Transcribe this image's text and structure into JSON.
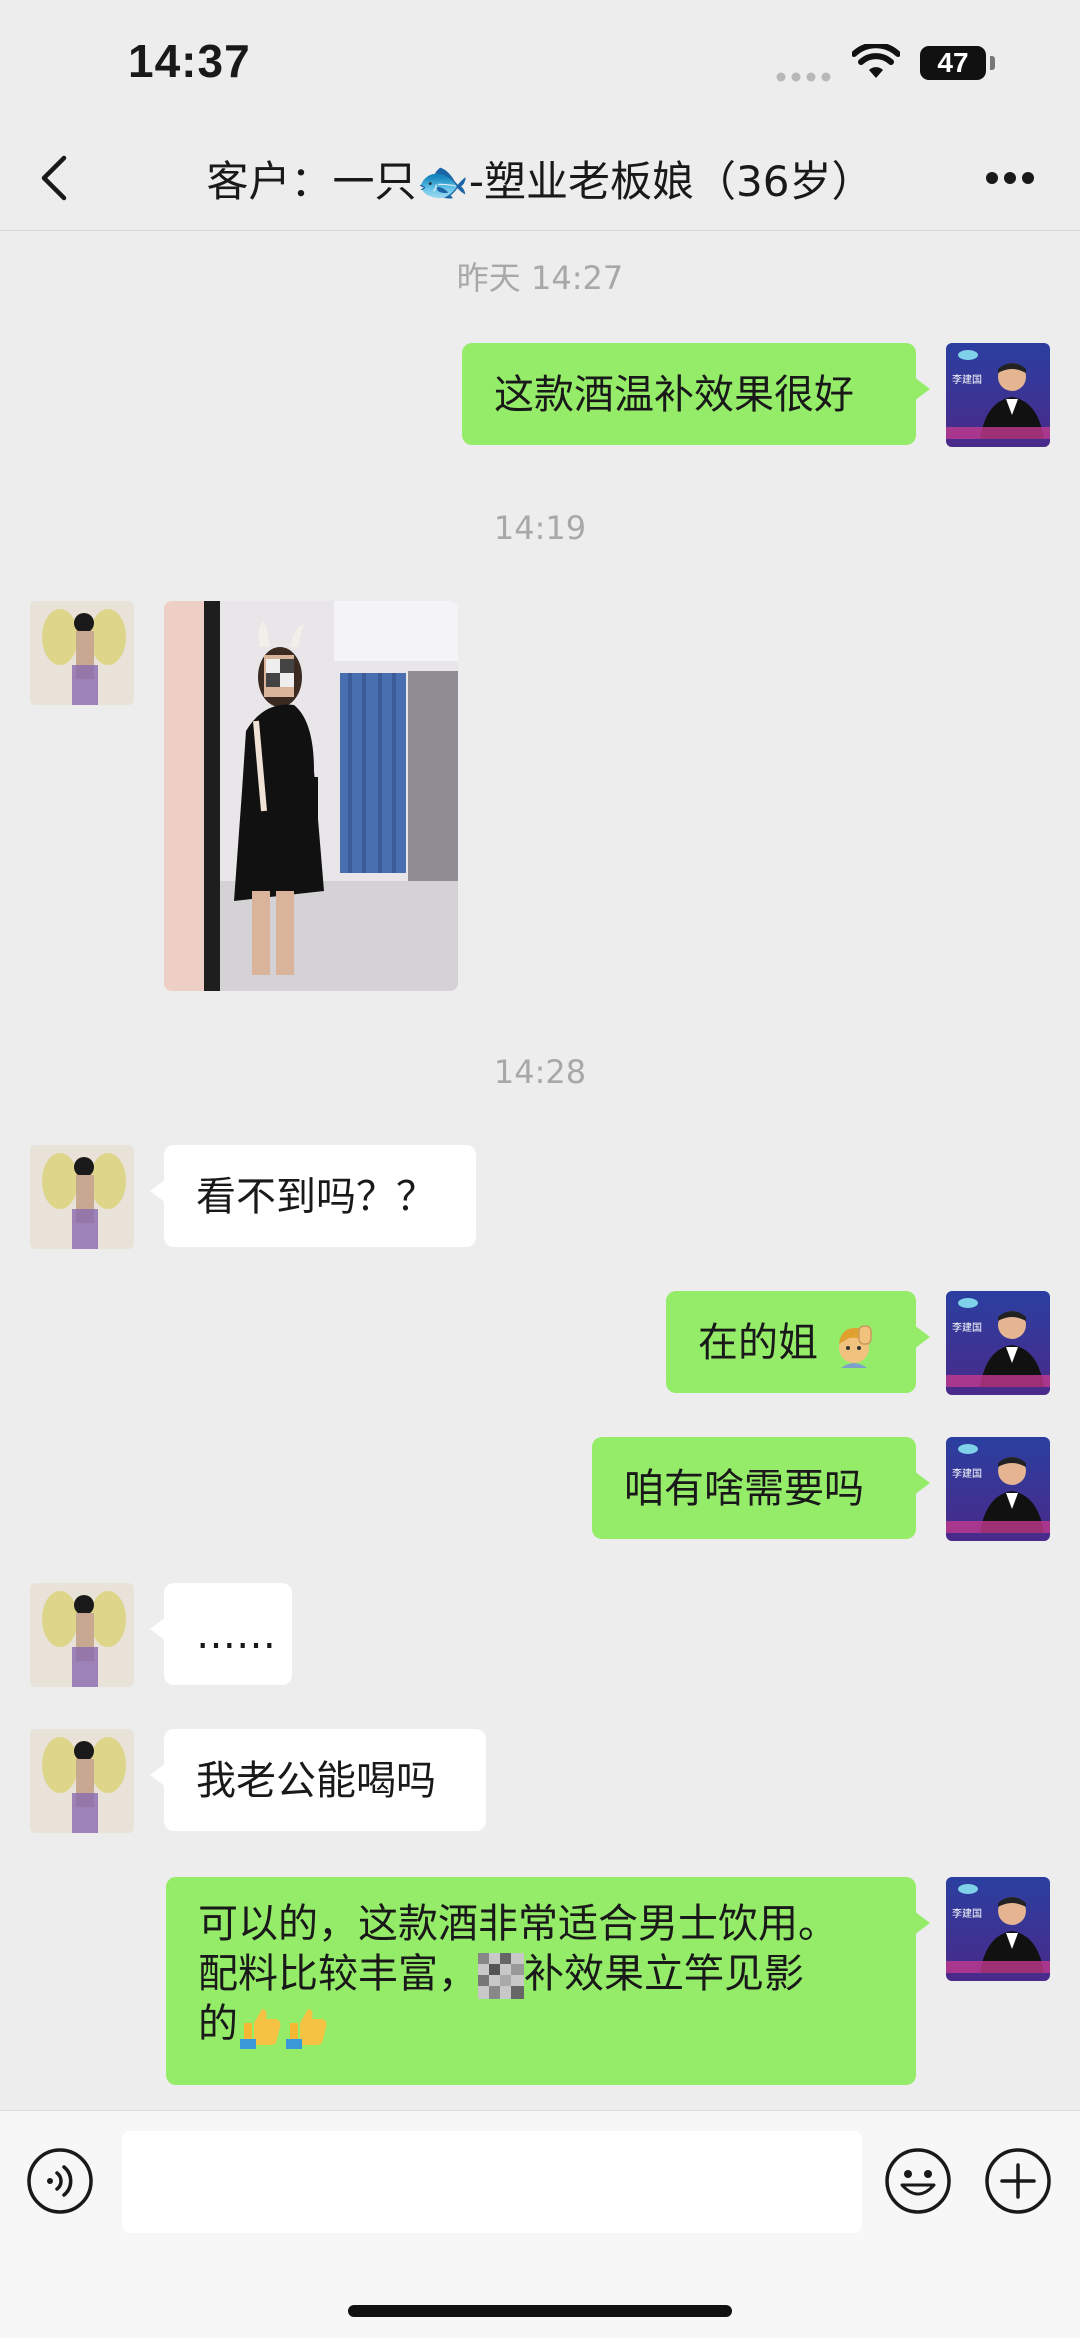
{
  "status_bar": {
    "time": "14:37",
    "battery": "47"
  },
  "nav": {
    "title": "客户：一只🐟-塑业老板娘（36岁）",
    "back_icon": "chevron-left-icon",
    "more_icon": "ellipsis-icon"
  },
  "messages": [
    {
      "type": "time",
      "text": "昨天 14:27"
    },
    {
      "type": "text",
      "side": "out",
      "text": "这款酒温补效果很好"
    },
    {
      "type": "time",
      "text": "14:19"
    },
    {
      "type": "image",
      "side": "in"
    },
    {
      "type": "time",
      "text": "14:28"
    },
    {
      "type": "text",
      "side": "in",
      "text": "看不到吗？？"
    },
    {
      "type": "text",
      "side": "out",
      "text": "在的姐"
    },
    {
      "type": "text",
      "side": "out",
      "text": "咱有啥需要吗"
    },
    {
      "type": "text",
      "side": "in",
      "text": "……"
    },
    {
      "type": "text",
      "side": "in",
      "text": "我老公能喝吗"
    },
    {
      "type": "text",
      "side": "out",
      "lines": [
        "可以的，这款酒非常适合男士饮用。",
        "配料比较丰富，",
        "补效果立竿见影",
        "的"
      ]
    }
  ],
  "avatars": {
    "out_card_name": "李建国"
  },
  "input_bar": {
    "voice_icon": "voice-icon",
    "emoji_icon": "emoji-icon",
    "plus_icon": "plus-icon"
  },
  "colors": {
    "background": "#ededed",
    "bubble_out": "#95ec69",
    "bubble_in": "#ffffff",
    "timestamp": "#a8a8a8"
  }
}
